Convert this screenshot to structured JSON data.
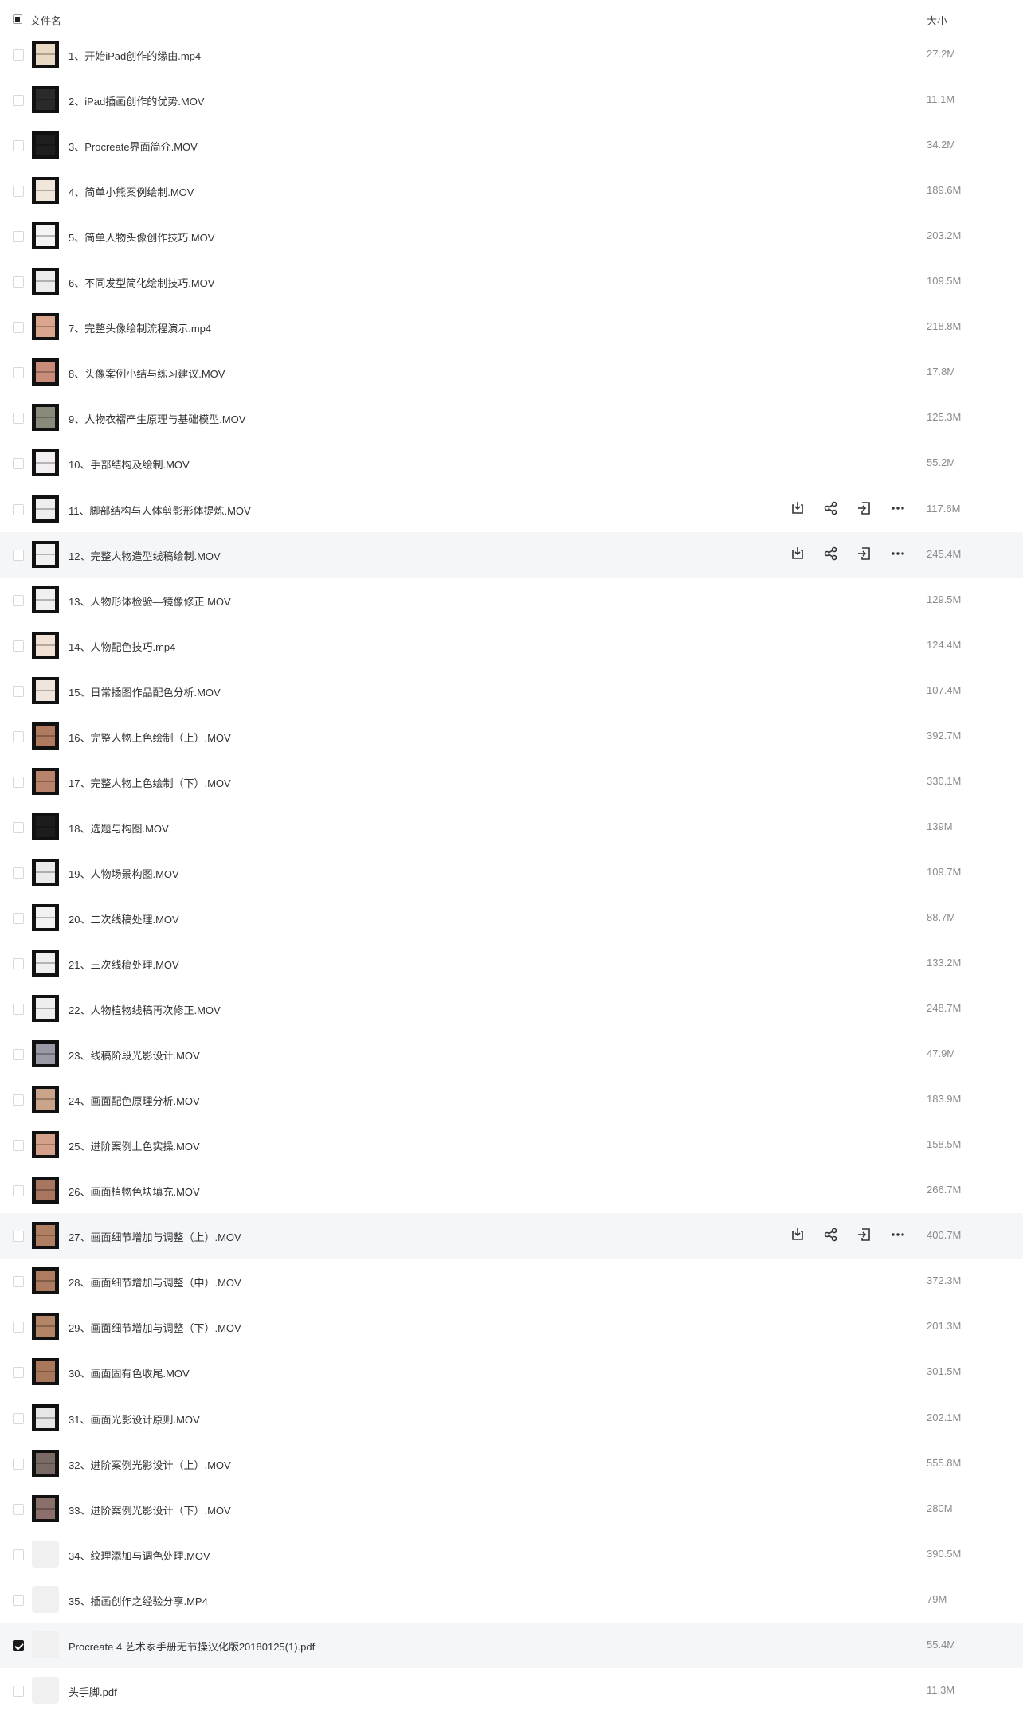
{
  "header": {
    "name_label": "文件名",
    "size_label": "大小"
  },
  "actions": {
    "download": "download-icon",
    "share": "share-icon",
    "move": "move-icon",
    "more": "more-icon"
  },
  "files": [
    {
      "name": "1、开始iPad创作的缘由.mp4",
      "size": "27.2M",
      "thumb": "#e9d9c4"
    },
    {
      "name": "2、iPad插画创作的优势.MOV",
      "size": "11.1M",
      "thumb": "#2a2a2a"
    },
    {
      "name": "3、Procreate界面简介.MOV",
      "size": "34.2M",
      "thumb": "#1e1e1e"
    },
    {
      "name": "4、简单小熊案例绘制.MOV",
      "size": "189.6M",
      "thumb": "#f1e6da"
    },
    {
      "name": "5、简单人物头像创作技巧.MOV",
      "size": "203.2M",
      "thumb": "#f4f4f4"
    },
    {
      "name": "6、不同发型简化绘制技巧.MOV",
      "size": "109.5M",
      "thumb": "#ececec"
    },
    {
      "name": "7、完整头像绘制流程演示.mp4",
      "size": "218.8M",
      "thumb": "#d9a58c"
    },
    {
      "name": "8、头像案例小结与练习建议.MOV",
      "size": "17.8M",
      "thumb": "#c98c78"
    },
    {
      "name": "9、人物衣褶产生原理与基础模型.MOV",
      "size": "125.3M",
      "thumb": "#8a8a7a"
    },
    {
      "name": "10、手部结构及绘制.MOV",
      "size": "55.2M",
      "thumb": "#f3eef2"
    },
    {
      "name": "11、脚部结构与人体剪影形体提炼.MOV",
      "size": "117.6M",
      "thumb": "#eeeeee"
    },
    {
      "name": "12、完整人物造型线稿绘制.MOV",
      "size": "245.4M",
      "thumb": "#f1f1f1"
    },
    {
      "name": "13、人物形体检验—镜像修正.MOV",
      "size": "129.5M",
      "thumb": "#f0f0f0"
    },
    {
      "name": "14、人物配色技巧.mp4",
      "size": "124.4M",
      "thumb": "#f2e2d6"
    },
    {
      "name": "15、日常插图作品配色分析.MOV",
      "size": "107.4M",
      "thumb": "#efe5dc"
    },
    {
      "name": "16、完整人物上色绘制（上）.MOV",
      "size": "392.7M",
      "thumb": "#b07a5e"
    },
    {
      "name": "17、完整人物上色绘制（下）.MOV",
      "size": "330.1M",
      "thumb": "#b9826a"
    },
    {
      "name": "18、选题与构图.MOV",
      "size": "139M",
      "thumb": "#1c1c1c"
    },
    {
      "name": "19、人物场景构图.MOV",
      "size": "109.7M",
      "thumb": "#eaeaea"
    },
    {
      "name": "20、二次线稿处理.MOV",
      "size": "88.7M",
      "thumb": "#f2f2f2"
    },
    {
      "name": "21、三次线稿处理.MOV",
      "size": "133.2M",
      "thumb": "#efefef"
    },
    {
      "name": "22、人物植物线稿再次修正.MOV",
      "size": "248.7M",
      "thumb": "#eeeeee"
    },
    {
      "name": "23、线稿阶段光影设计.MOV",
      "size": "47.9M",
      "thumb": "#9a9aa6"
    },
    {
      "name": "24、画面配色原理分析.MOV",
      "size": "183.9M",
      "thumb": "#c9a48a"
    },
    {
      "name": "25、进阶案例上色实操.MOV",
      "size": "158.5M",
      "thumb": "#d4a08a"
    },
    {
      "name": "26、画面植物色块填充.MOV",
      "size": "266.7M",
      "thumb": "#a8765e"
    },
    {
      "name": "27、画面细节增加与调整（上）.MOV",
      "size": "400.7M",
      "thumb": "#b07e60"
    },
    {
      "name": "28、画面细节增加与调整（中）.MOV",
      "size": "372.3M",
      "thumb": "#ad7b5f"
    },
    {
      "name": "29、画面细节增加与调整（下）.MOV",
      "size": "201.3M",
      "thumb": "#b38566"
    },
    {
      "name": "30、画面固有色收尾.MOV",
      "size": "301.5M",
      "thumb": "#a9785c"
    },
    {
      "name": "31、画面光影设计原则.MOV",
      "size": "202.1M",
      "thumb": "#e6e6e6"
    },
    {
      "name": "32、进阶案例光影设计（上）.MOV",
      "size": "555.8M",
      "thumb": "#7a6a66"
    },
    {
      "name": "33、进阶案例光影设计（下）.MOV",
      "size": "280M",
      "thumb": "#8a6f6a"
    },
    {
      "name": "34、纹理添加与调色处理.MOV",
      "size": "390.5M",
      "thumb": ""
    },
    {
      "name": "35、插画创作之经验分享.MP4",
      "size": "79M",
      "thumb": ""
    },
    {
      "name": "Procreate 4 艺术家手册无节操汉化版20180125(1).pdf",
      "size": "55.4M",
      "thumb": ""
    },
    {
      "name": "头手脚.pdf",
      "size": "11.3M",
      "thumb": ""
    }
  ]
}
